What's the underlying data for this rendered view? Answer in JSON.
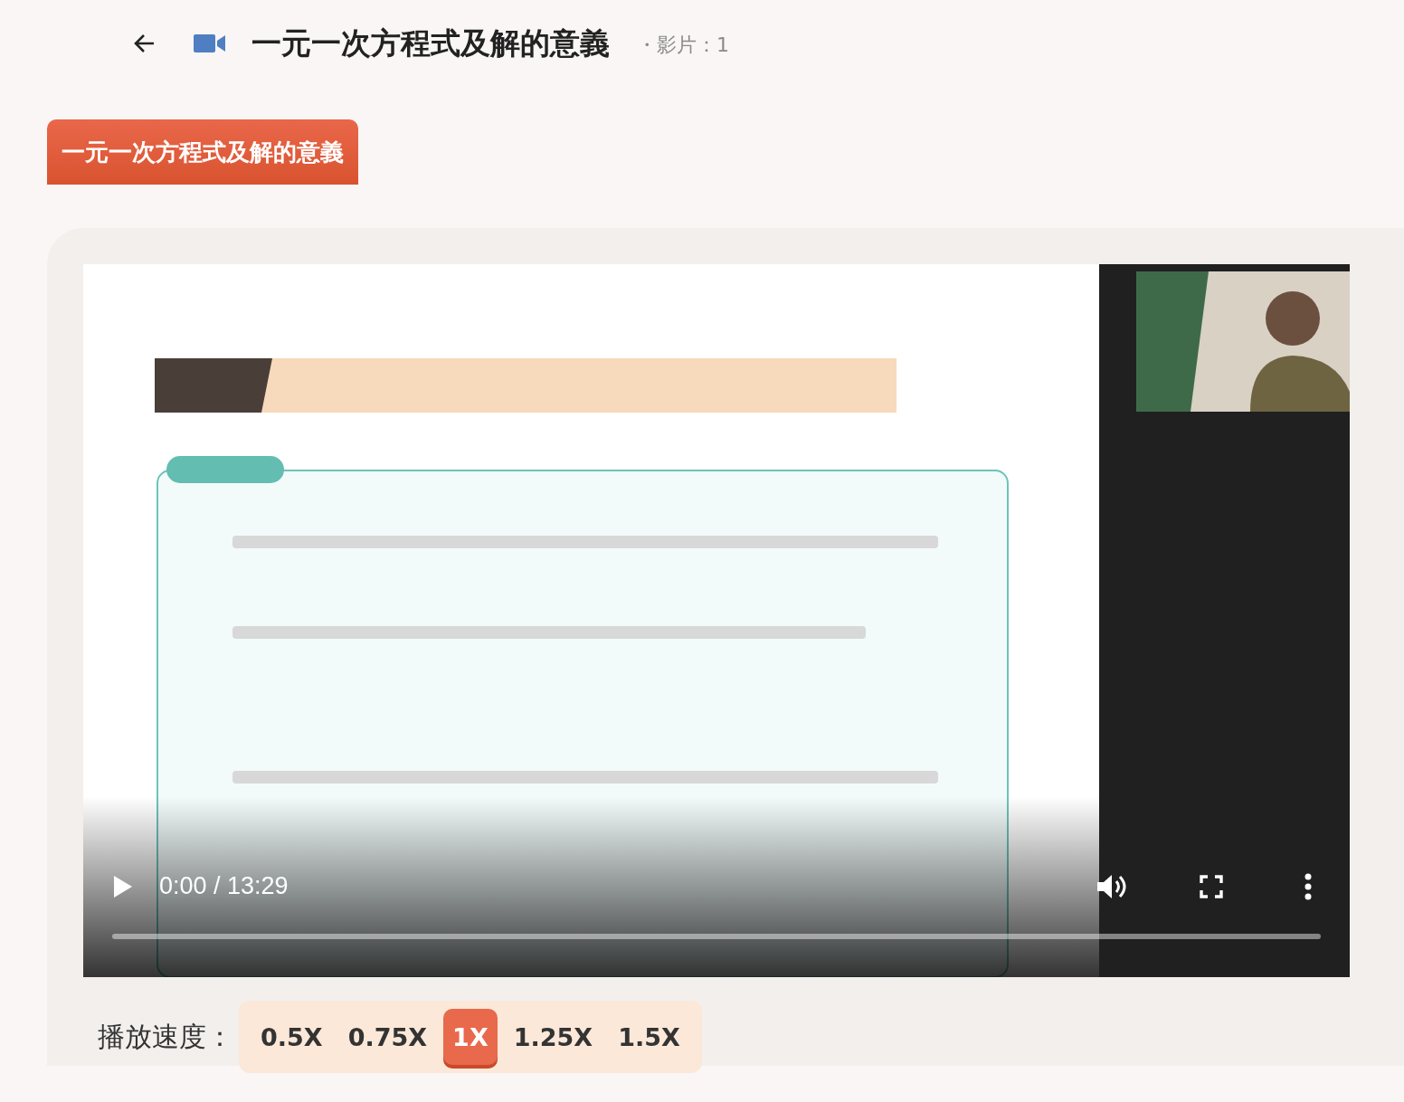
{
  "header": {
    "title": "一元一次方程式及解的意義",
    "video_count": "・影片：1"
  },
  "chapter_tab": {
    "label": "一元一次方程式及解的意義",
    "selected": true
  },
  "player": {
    "kind": "picture",
    "time": "0:00 / 13:29",
    "progress": {
      "level": 0
    }
  },
  "speed": {
    "label": "播放速度：",
    "options": [
      {
        "label": "0.5X",
        "selected": false
      },
      {
        "label": "0.75X",
        "selected": false
      },
      {
        "label": "1X",
        "selected": true
      },
      {
        "label": "1.25X",
        "selected": false
      },
      {
        "label": "1.5X",
        "selected": false
      }
    ]
  }
}
